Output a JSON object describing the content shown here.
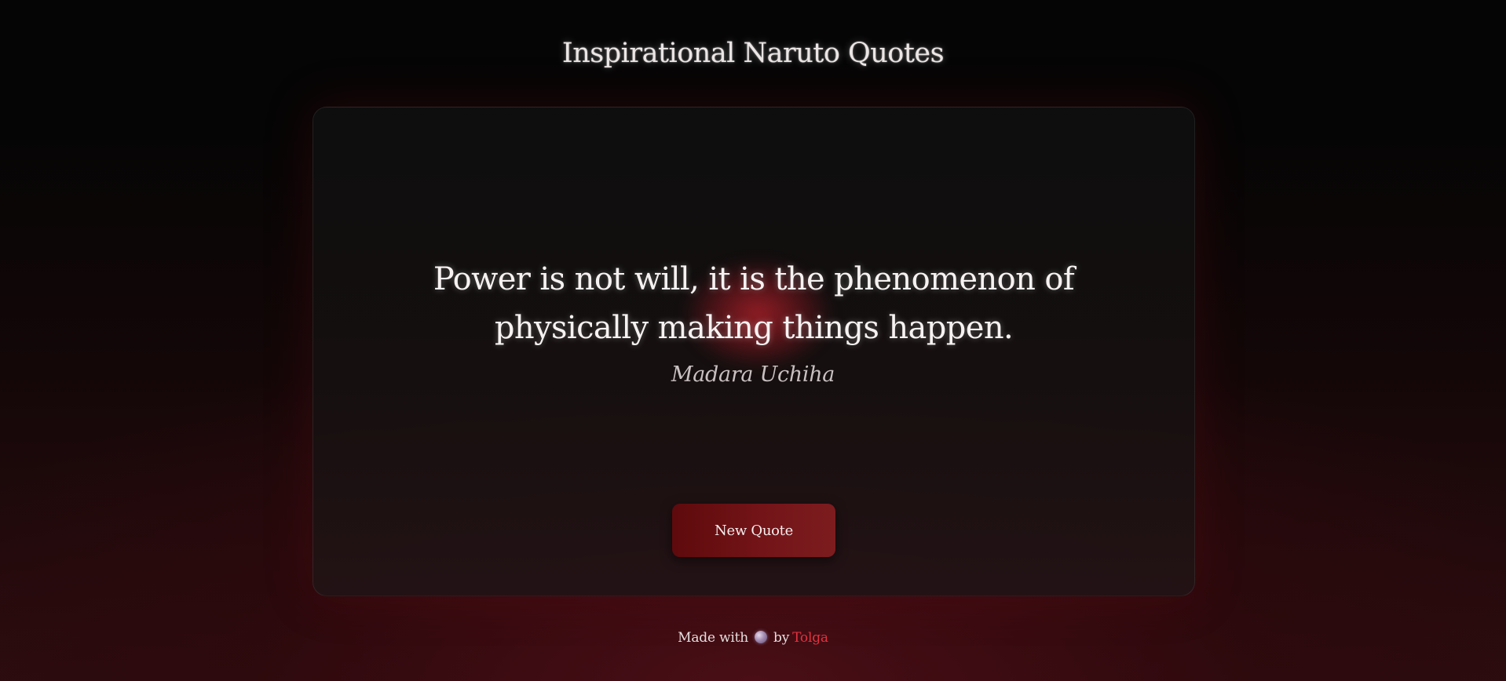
{
  "header": {
    "title": "Inspirational Naruto Quotes"
  },
  "quote": {
    "text": "Power is not will, it is the phenomenon of physically making things happen.",
    "author": "Madara Uchiha"
  },
  "actions": {
    "new_quote_label": "New Quote"
  },
  "footer": {
    "made_with": "Made with",
    "by": "by",
    "author_name": "Tolga",
    "icon": "heart-icon"
  },
  "colors": {
    "accent": "#e2323f",
    "button": "#731418",
    "background_bottom": "#2c0d0f"
  }
}
